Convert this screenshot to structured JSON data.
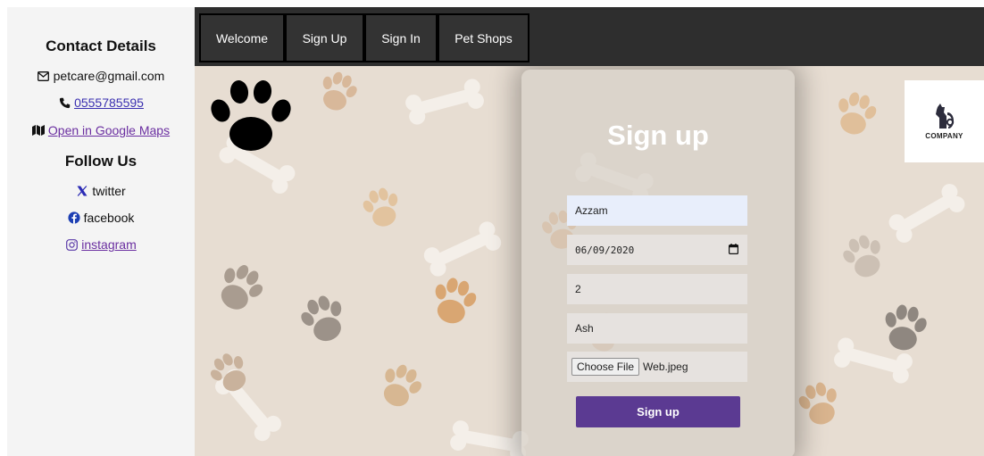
{
  "sidebar": {
    "contact_heading": "Contact Details",
    "email": "petcare@gmail.com",
    "phone": "0555785595",
    "maps_link": "Open in Google Maps",
    "follow_heading": "Follow Us",
    "social": [
      {
        "label": "twitter",
        "icon": "x-icon"
      },
      {
        "label": "facebook",
        "icon": "facebook-icon"
      },
      {
        "label": " instagram",
        "icon": "instagram-icon"
      }
    ]
  },
  "nav": {
    "items": [
      "Welcome",
      "Sign Up",
      "Sign In",
      "Pet Shops"
    ]
  },
  "logo": {
    "text": "COMPANY"
  },
  "signup": {
    "title": "Sign up",
    "name_value": "Azzam",
    "date_value": "06/09/2020",
    "number_value": "2",
    "pet_value": "Ash",
    "file_button": "Choose File",
    "file_name": "Web.jpeg",
    "submit_label": "Sign up"
  },
  "colors": {
    "nav_bg": "#2e2e2e",
    "sidebar_bg": "#f4f4f4",
    "submit_bg": "#5b3a92",
    "link": "#3a2fb0"
  }
}
